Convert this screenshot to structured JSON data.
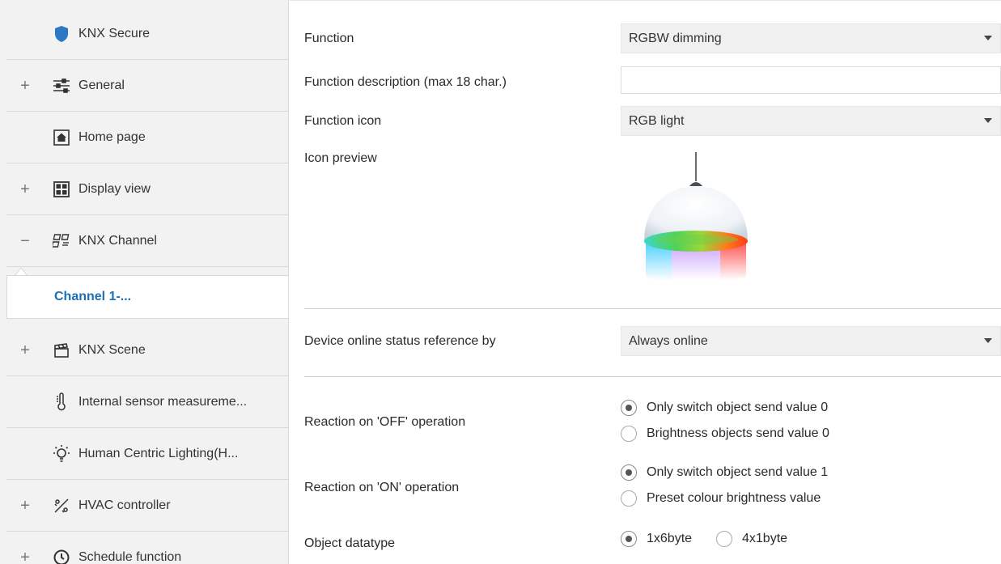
{
  "sidebar": {
    "items": [
      {
        "label": "KNX Secure",
        "expander": "",
        "icon": "shield-icon"
      },
      {
        "label": "General",
        "expander": "+",
        "icon": "sliders-icon"
      },
      {
        "label": "Home page",
        "expander": "",
        "icon": "home-icon"
      },
      {
        "label": "Display view",
        "expander": "+",
        "icon": "grid-icon"
      },
      {
        "label": "KNX Channel",
        "expander": "−",
        "icon": "channel-icon"
      },
      {
        "label": "Channel 1-...",
        "expander": "",
        "icon": ""
      },
      {
        "label": "KNX Scene",
        "expander": "+",
        "icon": "clapperboard-icon"
      },
      {
        "label": "Internal sensor measureme...",
        "expander": "",
        "icon": "thermometer-icon"
      },
      {
        "label": "Human Centric Lighting(H...",
        "expander": "",
        "icon": "lightbulb-icon"
      },
      {
        "label": "HVAC controller",
        "expander": "+",
        "icon": "hvac-icon"
      },
      {
        "label": "Schedule function",
        "expander": "+",
        "icon": "clock-icon"
      }
    ]
  },
  "main": {
    "function": {
      "label": "Function",
      "value": "RGBW dimming"
    },
    "function_description": {
      "label": "Function description (max 18 char.)",
      "value": ""
    },
    "function_icon": {
      "label": "Function icon",
      "value": "RGB light"
    },
    "icon_preview": {
      "label": "Icon preview",
      "image": "rgb-pendant-lamp-icon"
    },
    "online_status": {
      "label": "Device online status reference by",
      "value": "Always online"
    },
    "reaction_off": {
      "label": "Reaction on 'OFF' operation",
      "options": [
        "Only switch object send value 0",
        "Brightness objects send value 0"
      ],
      "selected": 0
    },
    "reaction_on": {
      "label": "Reaction on 'ON' operation",
      "options": [
        "Only switch object send value 1",
        "Preset colour brightness value"
      ],
      "selected": 0
    },
    "object_datatype": {
      "label": "Object datatype",
      "options": [
        "1x6byte",
        "4x1byte"
      ],
      "selected": 0
    }
  },
  "colors": {
    "accent": "#1f6fb3",
    "sidebar_bg": "#f2f2f2",
    "select_bg": "#f0f0f0"
  }
}
